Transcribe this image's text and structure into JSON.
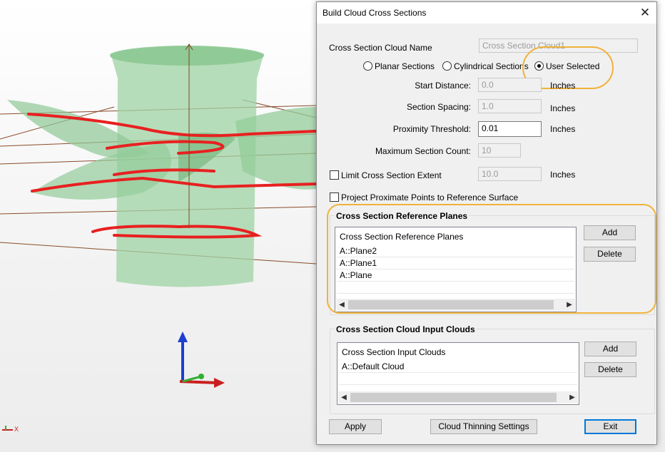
{
  "dialog": {
    "title": "Build Cloud Cross Sections",
    "close_icon": "close-icon",
    "cloud_name_label": "Cross Section Cloud Name",
    "cloud_name_value": "Cross Section Cloud1",
    "section_type": {
      "options": [
        "Planar Sections",
        "Cylindrical Sections",
        "User Selected"
      ],
      "selected": "User Selected"
    },
    "start_distance": {
      "label": "Start Distance:",
      "value": "0.0",
      "unit": "Inches"
    },
    "section_spacing": {
      "label": "Section Spacing:",
      "value": "1.0",
      "unit": "Inches"
    },
    "proximity_threshold": {
      "label": "Proximity Threshold:",
      "value": "0.01",
      "unit": "Inches"
    },
    "max_section_count": {
      "label": "Maximum Section Count:",
      "value": "10"
    },
    "limit_extent": {
      "label": "Limit Cross Section Extent",
      "value": "10.0",
      "unit": "Inches",
      "checked": false
    },
    "project_points": {
      "label": "Project Proximate Points to Reference Surface",
      "checked": false
    },
    "ref_planes": {
      "group_title": "Cross Section Reference Planes",
      "list_header": "Cross Section Reference Planes",
      "items": [
        "A::Plane2",
        "A::Plane1",
        "A::Plane"
      ],
      "add_label": "Add",
      "delete_label": "Delete"
    },
    "input_clouds": {
      "group_title": "Cross Section Cloud Input Clouds",
      "list_header": "Cross Section Input Clouds",
      "items": [
        "A::Default Cloud"
      ],
      "add_label": "Add",
      "delete_label": "Delete"
    },
    "apply_label": "Apply",
    "thinning_label": "Cloud Thinning Settings",
    "exit_label": "Exit"
  },
  "viewport": {
    "axis_x_label": "X",
    "highlight_color": "#f0b23a",
    "section_color": "#e82020"
  }
}
